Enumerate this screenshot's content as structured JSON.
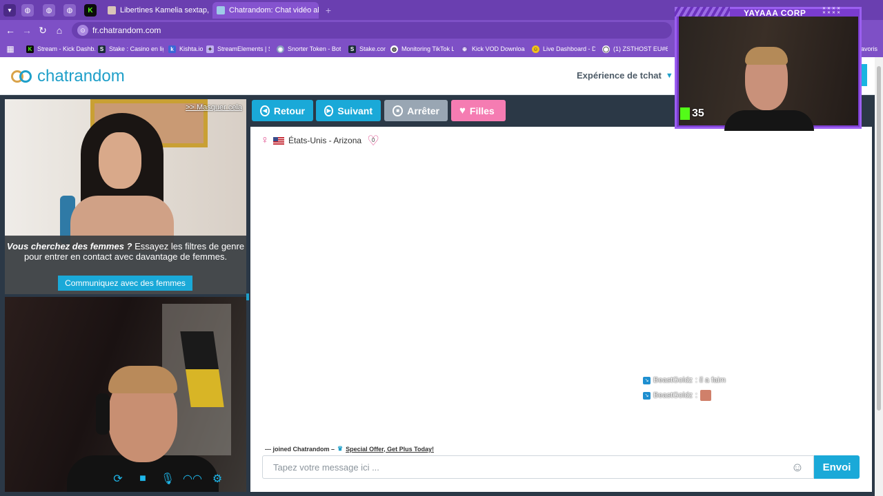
{
  "browser": {
    "tabs": [
      {
        "title": "Libertines Kamelia sextap, Stra",
        "active": false
      },
      {
        "title": "Chatrandom: Chat vidéo al",
        "active": true
      }
    ],
    "url": "fr.chatrandom.com",
    "bookmarks": [
      "Stream - Kick Dashb...",
      "Stake : Casino en lig...",
      "Kishta.io",
      "StreamElements | S...",
      "Snorter Token - Bot...",
      "Stake.com",
      "Monitoring TikTok L...",
      "Kick VOD Download...",
      "Live Dashboard - DL...",
      "(1) ZSTHOST EU#6-...",
      "avoris"
    ]
  },
  "site": {
    "logo_text": "chatrandom",
    "header_link": "Expérience de tchat",
    "ad": {
      "hide_link": ">> Masquer cela",
      "text_bold": "Vous cherchez des femmes ?",
      "text_rest": " Essayez les filtres de genre pour entrer en contact avec davantage de femmes.",
      "button": "Communiquez avec des femmes"
    },
    "toolbar": {
      "back": "Retour",
      "next": "Suivant",
      "stop": "Arrêter",
      "girls": "Filles"
    },
    "stranger": {
      "location": "États-Unis - Arizona",
      "likes": "0"
    },
    "chat_lines": [
      {
        "user": "BeastGoldz",
        "text": ": il a faim"
      },
      {
        "user": "BeastGoldz",
        "text": ":"
      }
    ],
    "joined_text": "--- joined Chatrandom –",
    "offer_link": "Special Offer, Get Plus Today!",
    "input_placeholder": "Tapez votre message ici ...",
    "send_button": "Envoi"
  },
  "stream_overlay": {
    "title": "YAYAAA CORP",
    "viewer_count": "35"
  }
}
